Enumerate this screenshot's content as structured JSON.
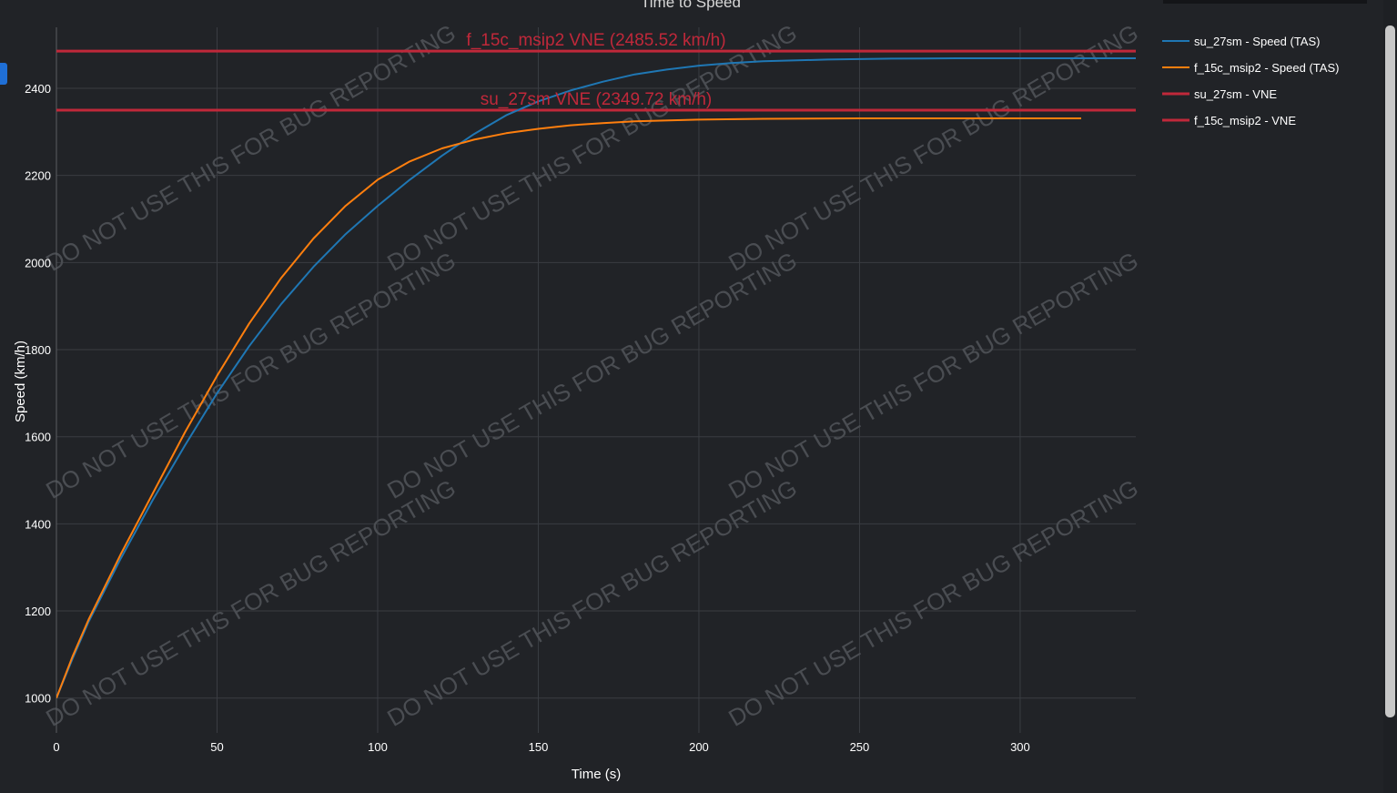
{
  "colors": {
    "background": "#212327",
    "grid": "#3a3d42",
    "series_blue": "#1f77b4",
    "series_orange": "#ff7f0e",
    "vne_red": "#c0283a",
    "watermark": "#4a4d52"
  },
  "watermark_text": "DO NOT USE THIS FOR BUG REPORTING",
  "chart_data": {
    "type": "line",
    "title": "Time to Speed",
    "xlabel": "Time (s)",
    "ylabel": "Speed (km/h)",
    "xlim": [
      0,
      336
    ],
    "ylim": [
      920,
      2540
    ],
    "x_ticks": [
      0,
      50,
      100,
      150,
      200,
      250,
      300
    ],
    "y_ticks": [
      1000,
      1200,
      1400,
      1600,
      1800,
      2000,
      2200,
      2400
    ],
    "grid": true,
    "legend_position": "top-right outside",
    "series": [
      {
        "name": "su_27sm - Speed (TAS)",
        "color": "#1f77b4",
        "points": [
          [
            0,
            1000
          ],
          [
            5,
            1090
          ],
          [
            10,
            1175
          ],
          [
            20,
            1320
          ],
          [
            30,
            1455
          ],
          [
            40,
            1580
          ],
          [
            50,
            1700
          ],
          [
            60,
            1808
          ],
          [
            70,
            1905
          ],
          [
            80,
            1990
          ],
          [
            90,
            2065
          ],
          [
            100,
            2130
          ],
          [
            110,
            2190
          ],
          [
            120,
            2245
          ],
          [
            130,
            2295
          ],
          [
            140,
            2338
          ],
          [
            150,
            2370
          ],
          [
            160,
            2395
          ],
          [
            170,
            2415
          ],
          [
            180,
            2432
          ],
          [
            190,
            2443
          ],
          [
            200,
            2452
          ],
          [
            210,
            2458
          ],
          [
            220,
            2462
          ],
          [
            240,
            2466
          ],
          [
            260,
            2468
          ],
          [
            280,
            2469
          ],
          [
            300,
            2469
          ],
          [
            336,
            2469
          ]
        ]
      },
      {
        "name": "f_15c_msip2 - Speed (TAS)",
        "color": "#ff7f0e",
        "points": [
          [
            0,
            1000
          ],
          [
            5,
            1095
          ],
          [
            10,
            1180
          ],
          [
            20,
            1330
          ],
          [
            30,
            1470
          ],
          [
            40,
            1610
          ],
          [
            50,
            1740
          ],
          [
            60,
            1860
          ],
          [
            70,
            1965
          ],
          [
            80,
            2055
          ],
          [
            90,
            2130
          ],
          [
            100,
            2190
          ],
          [
            110,
            2232
          ],
          [
            120,
            2262
          ],
          [
            130,
            2282
          ],
          [
            140,
            2297
          ],
          [
            150,
            2307
          ],
          [
            160,
            2315
          ],
          [
            170,
            2320
          ],
          [
            180,
            2324
          ],
          [
            200,
            2328
          ],
          [
            220,
            2330
          ],
          [
            250,
            2331
          ],
          [
            280,
            2331
          ],
          [
            300,
            2331
          ],
          [
            319,
            2331
          ]
        ]
      },
      {
        "name": "su_27sm - VNE",
        "color": "#c0283a",
        "constant": 2349.72,
        "x_range": [
          0,
          336
        ]
      },
      {
        "name": "f_15c_msip2 - VNE",
        "color": "#c0283a",
        "constant": 2485.52,
        "x_range": [
          0,
          336
        ]
      }
    ],
    "annotations": [
      {
        "text": "f_15c_msip2 VNE (2485.52 km/h)",
        "x": 168,
        "y": 2485.52
      },
      {
        "text": "su_27sm VNE (2349.72 km/h)",
        "x": 168,
        "y": 2349.72
      }
    ]
  }
}
